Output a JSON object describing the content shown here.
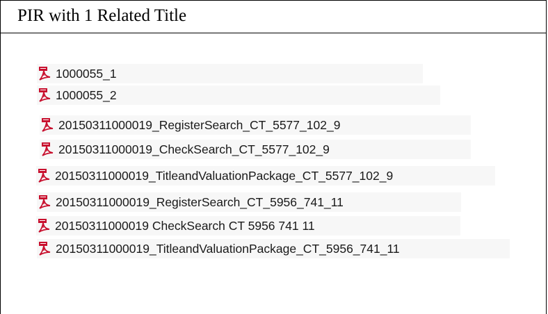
{
  "header": {
    "title": "PIR with 1 Related Title"
  },
  "files": [
    {
      "name": "1000055_1",
      "icon": "pdf-icon"
    },
    {
      "name": "1000055_2",
      "icon": "pdf-icon"
    },
    {
      "name": "20150311000019_RegisterSearch_CT_5577_102_9",
      "icon": "pdf-icon"
    },
    {
      "name": "20150311000019_CheckSearch_CT_5577_102_9",
      "icon": "pdf-icon"
    },
    {
      "name": "20150311000019_TitleandValuationPackage_CT_5577_102_9",
      "icon": "pdf-icon"
    },
    {
      "name": "20150311000019_RegisterSearch_CT_5956_741_11",
      "icon": "pdf-icon"
    },
    {
      "name": "20150311000019 CheckSearch CT 5956 741 11",
      "icon": "pdf-icon"
    },
    {
      "name": "20150311000019_TitleandValuationPackage_CT_5956_741_11",
      "icon": "pdf-icon"
    }
  ],
  "colors": {
    "pdf_icon_red": "#c8102e",
    "row_background": "#f7f7f7"
  }
}
